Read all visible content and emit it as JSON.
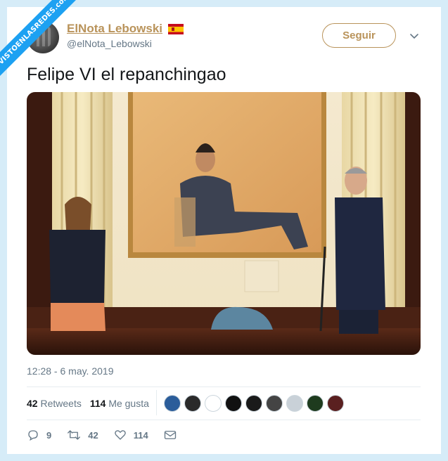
{
  "watermark": "VISTOENLASREDES.com",
  "user": {
    "display_name": "ElNota Lebowski",
    "handle": "@elNota_Lebowski",
    "flag_icon": "spain-flag-icon"
  },
  "follow_label": "Seguir",
  "tweet_text": "Felipe VI el repanchingao",
  "timestamp": "12:28 - 6 may. 2019",
  "stats": {
    "retweets_count": "42",
    "retweets_label": "Retweets",
    "likes_count": "114",
    "likes_label": "Me gusta"
  },
  "likers": [
    "#2b5d9a",
    "#2a2a2a",
    "#ffffff",
    "#111111",
    "#1a1a1a",
    "#444444",
    "#c9d1d8",
    "#1e3b1e",
    "#5a2020"
  ],
  "actions": {
    "replies": "9",
    "retweets": "42",
    "likes": "114"
  },
  "colors": {
    "accent": "#b9935a",
    "muted": "#657786",
    "background": "#d6ecf8"
  }
}
